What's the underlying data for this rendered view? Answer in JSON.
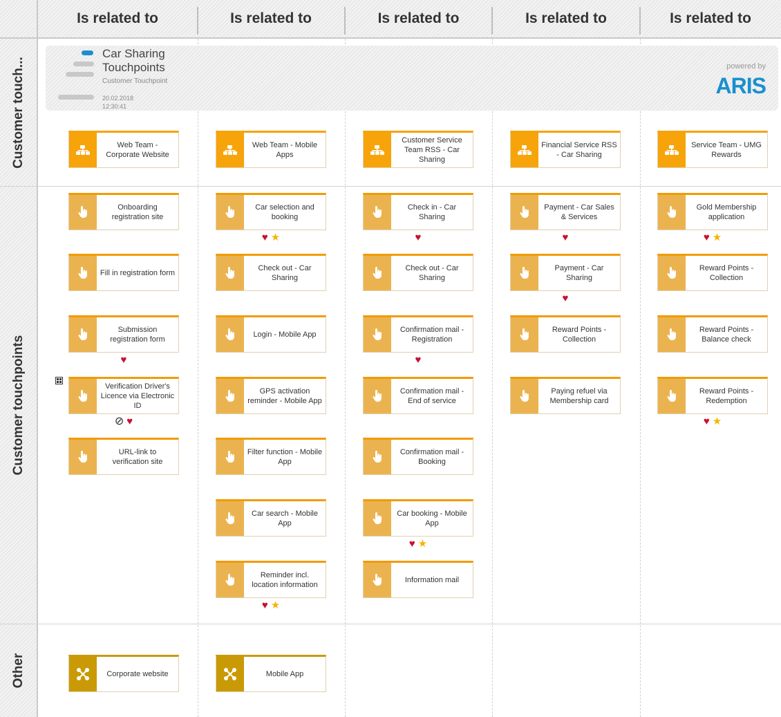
{
  "columns": [
    "Is related to",
    "Is related to",
    "Is related to",
    "Is related to",
    "Is related to"
  ],
  "rows": [
    "Customer touch...",
    "Customer touchpoints",
    "Other"
  ],
  "legend": {
    "title_line1": "Car Sharing",
    "title_line2": "Touchpoints",
    "subtitle": "Customer Touchpoint",
    "date": "20.02.2018",
    "time": "12:30:41",
    "powered_by": "powered by",
    "brand": "ARIS"
  },
  "org_units": [
    "Web Team - Corporate Website",
    "Web Team - Mobile Apps",
    "Customer Service Team RSS - Car Sharing",
    "Financial Service RSS - Car Sharing",
    "Service Team - UMG Rewards"
  ],
  "touchpoints": [
    [
      "Onboarding registration site",
      "Fill in registration form",
      "Submission registration form",
      "Verification Driver's Licence via Electronic ID",
      "URL-link to verification site"
    ],
    [
      "Car selection and booking",
      "Check out - Car Sharing",
      "Login - Mobile App",
      "GPS activation reminder - Mobile App",
      "Filter function - Mobile App",
      "Car search - Mobile App",
      "Reminder incl. location information"
    ],
    [
      "Check in - Car Sharing",
      "Check out - Car Sharing",
      "Confirmation mail - Registration",
      "Confirmation mail - End of service",
      "Confirmation mail - Booking",
      "Car booking - Mobile App",
      "Information mail"
    ],
    [
      "Payment - Car Sales & Services",
      "Payment - Car Sharing",
      "Reward Points - Collection",
      "Paying refuel via Membership card"
    ],
    [
      "Gold Membership application",
      "Reward Points - Collection",
      "Reward Points - Balance check",
      "Reward Points - Redemption"
    ]
  ],
  "other": [
    "Corporate website",
    "Mobile App"
  ],
  "icons": {
    "org": "org-chart-icon",
    "touch": "hand-pointer-icon",
    "system": "network-icon",
    "heart": "heart-icon",
    "star": "star-icon",
    "noentry": "no-entry-icon",
    "grid": "grid-icon"
  },
  "colors": {
    "org": "#f7a30a",
    "touch": "#ebb350",
    "other": "#c99a06",
    "heart": "#c8102e",
    "star": "#f4b400",
    "brand": "#1a8fcf"
  }
}
